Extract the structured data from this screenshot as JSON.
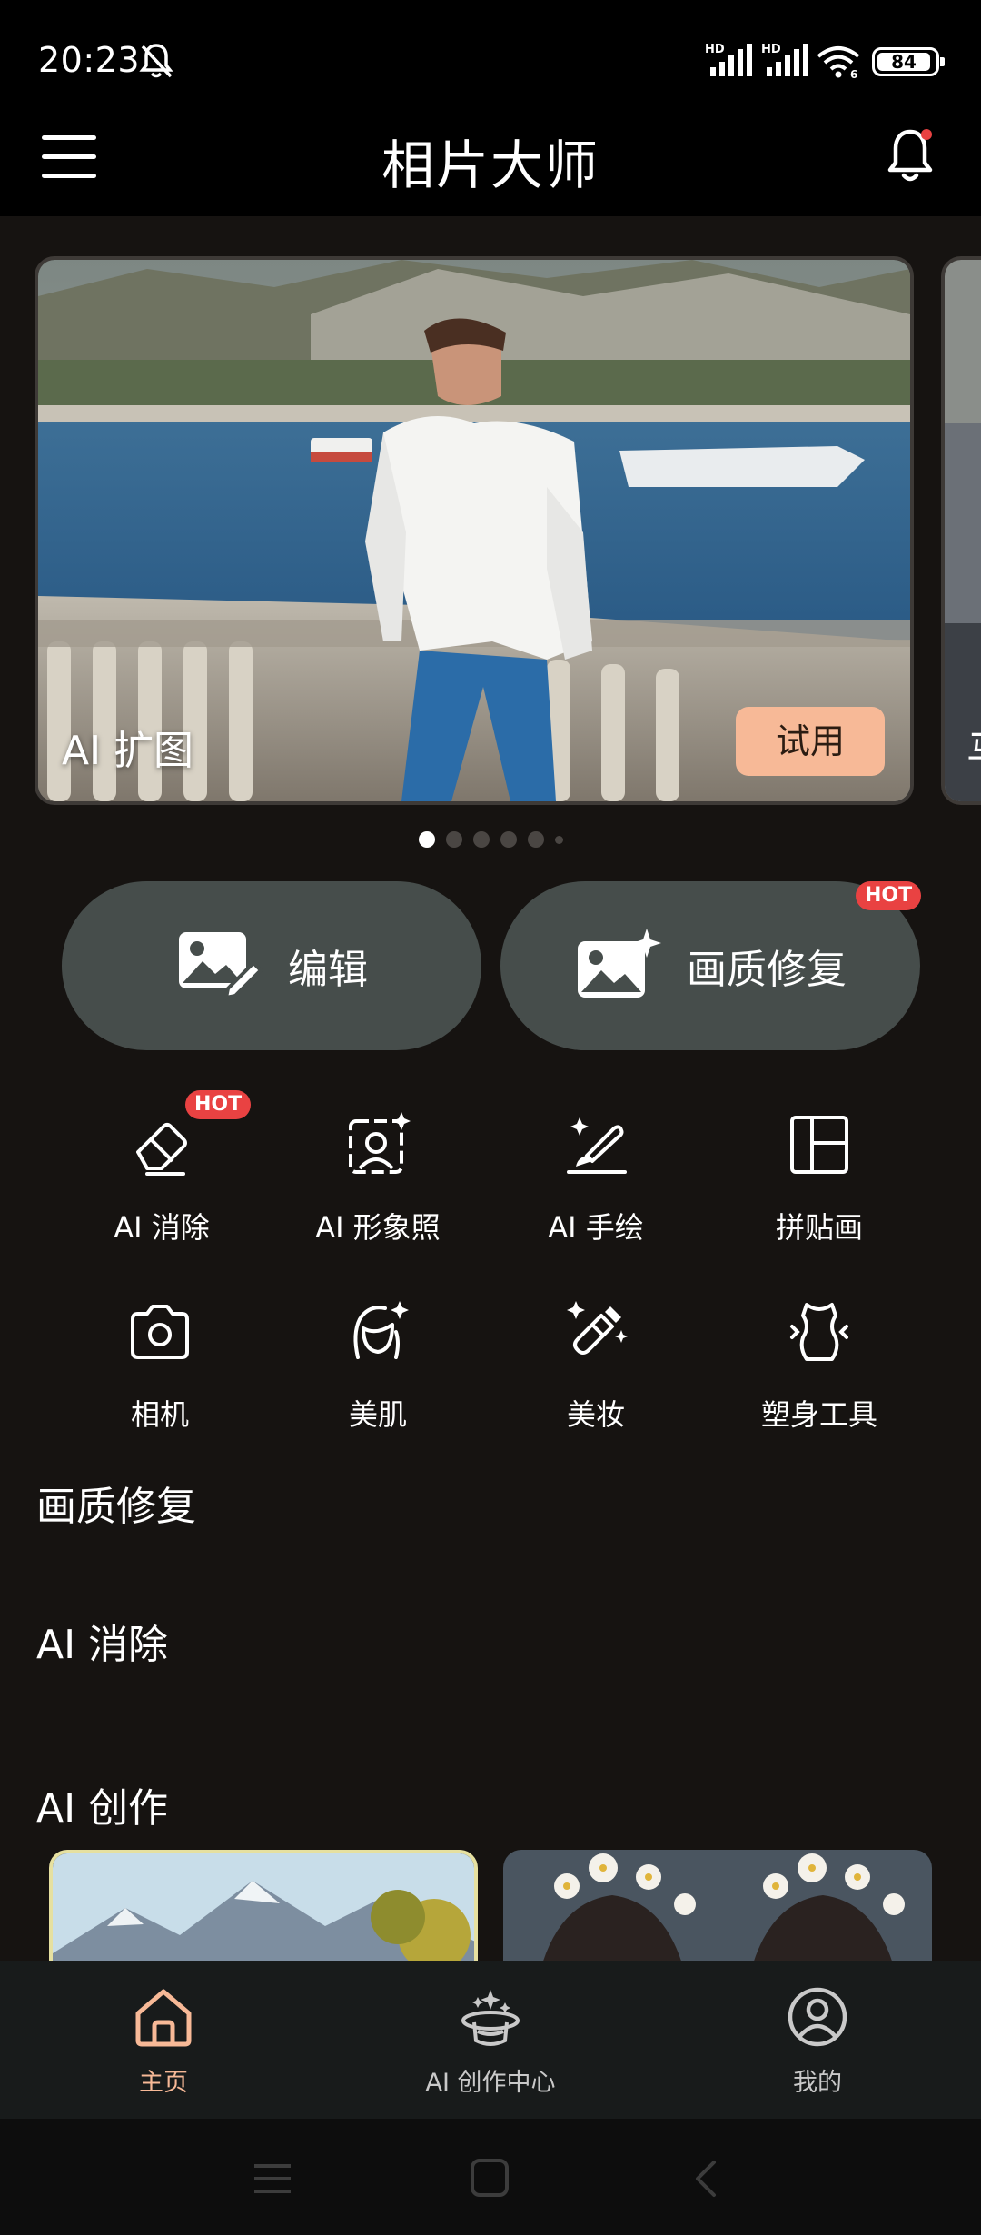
{
  "status": {
    "time": "20:23",
    "signal1": "HD",
    "signal2": "HD",
    "wifi_sub": "6",
    "battery": "84"
  },
  "header": {
    "title": "相片大师"
  },
  "banner": {
    "label": "AI 扩图",
    "try_label": "试用",
    "peek_label": "马",
    "dots": 6,
    "active_dot": 0
  },
  "big_buttons": {
    "edit": "编辑",
    "restore": "画质修复",
    "hot": "HOT"
  },
  "tools": [
    {
      "label": "AI 消除",
      "icon": "eraser-icon",
      "hot": "HOT"
    },
    {
      "label": "AI 形象照",
      "icon": "portrait-icon"
    },
    {
      "label": "AI 手绘",
      "icon": "brush-icon"
    },
    {
      "label": "拼贴画",
      "icon": "collage-icon"
    },
    {
      "label": "相机",
      "icon": "camera-icon"
    },
    {
      "label": "美肌",
      "icon": "face-sparkle-icon"
    },
    {
      "label": "美妆",
      "icon": "makeup-brush-icon"
    },
    {
      "label": "塑身工具",
      "icon": "body-shape-icon"
    }
  ],
  "sections": {
    "restore": "画质修复",
    "erase": "AI 消除",
    "creation": "AI 创作"
  },
  "nav": {
    "home": "主页",
    "ai_center": "AI 创作中心",
    "mine": "我的"
  },
  "colors": {
    "accent": "#f7b997",
    "hot": "#e94242",
    "button_bg": "#464d4b",
    "background": "#161311"
  }
}
